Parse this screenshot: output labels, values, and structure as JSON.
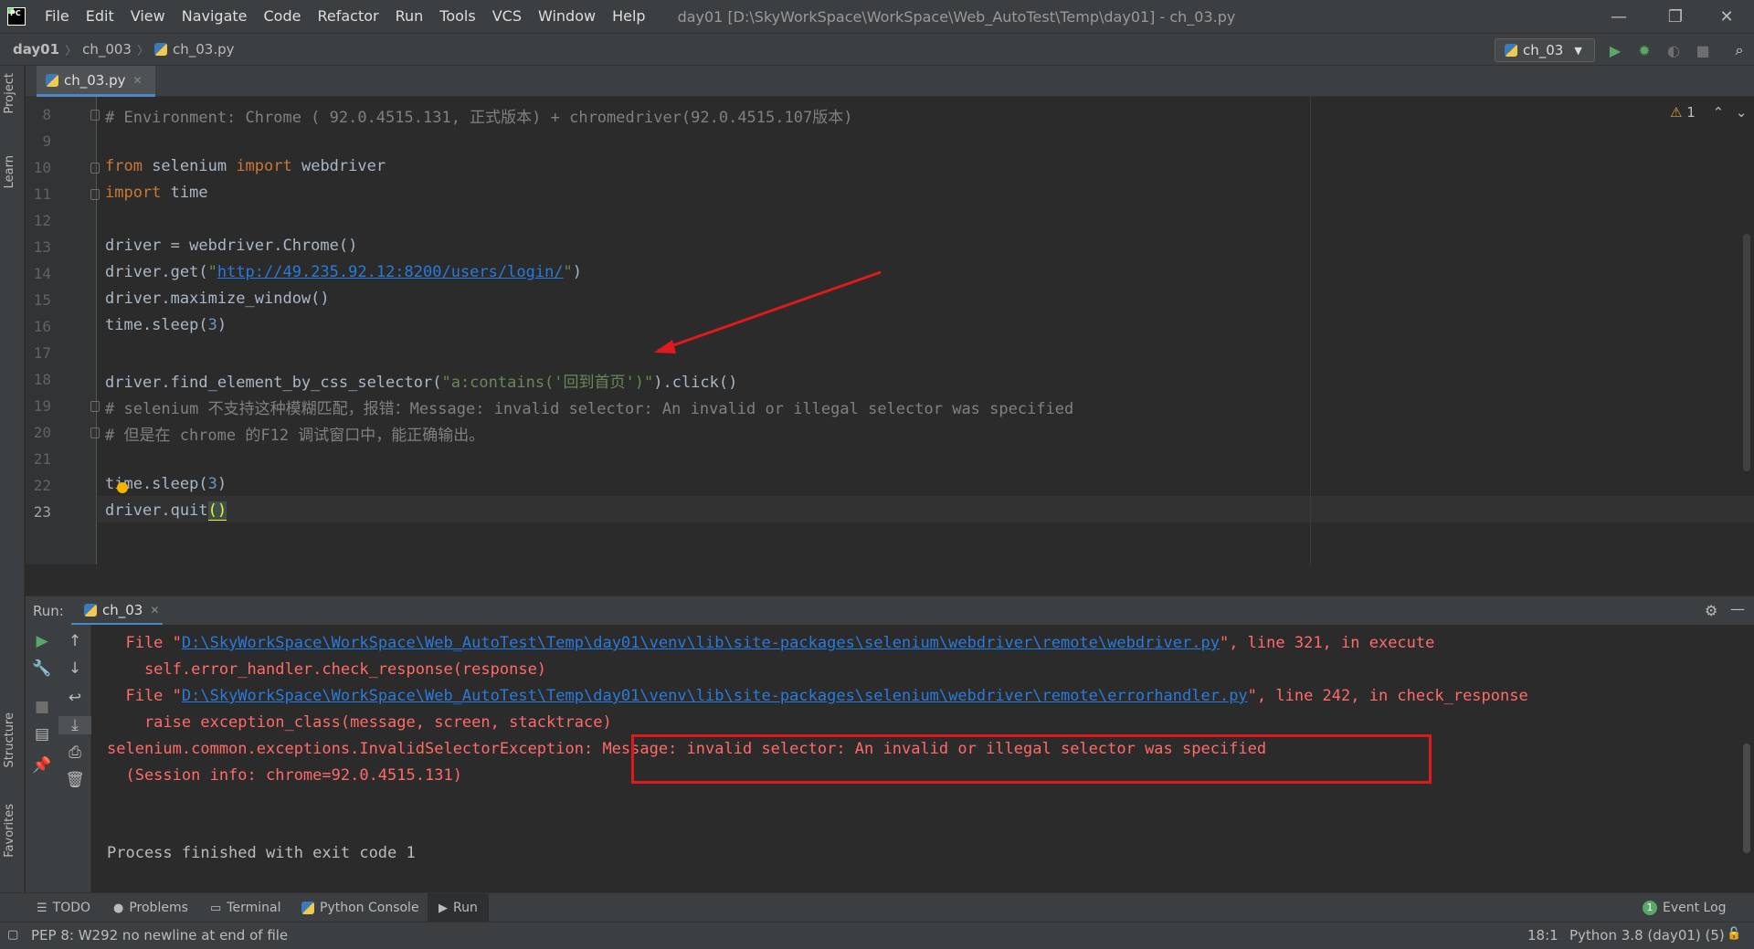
{
  "menubar": {
    "items": [
      "File",
      "Edit",
      "View",
      "Navigate",
      "Code",
      "Refactor",
      "Run",
      "Tools",
      "VCS",
      "Window",
      "Help"
    ],
    "title": "day01 [D:\\SkyWorkSpace\\WorkSpace\\Web_AutoTest\\Temp\\day01] - ch_03.py"
  },
  "navbar": {
    "crumbs": [
      "day01",
      "ch_003",
      "ch_03.py"
    ],
    "run_config": "ch_03"
  },
  "left_strip": {
    "project": "Project",
    "learn": "Learn",
    "structure": "Structure",
    "favorites": "Favorites"
  },
  "editor": {
    "tab_label": "ch_03.py",
    "warnings": "1",
    "line_numbers": [
      "8",
      "9",
      "10",
      "11",
      "12",
      "13",
      "14",
      "15",
      "16",
      "17",
      "18",
      "19",
      "20",
      "21",
      "22",
      "23"
    ],
    "lines": {
      "l8": "# Environment: Chrome ( 92.0.4515.131, 正式版本) + chromedriver(92.0.4515.107版本)",
      "l10_kw1": "from",
      "l10_mod": " selenium ",
      "l10_kw2": "import",
      "l10_rest": " webdriver",
      "l11_kw": "import",
      "l11_rest": " time",
      "l13": "driver = webdriver.Chrome()",
      "l14_a": "driver.get(",
      "l14_q1": "\"",
      "l14_url": "http://49.235.92.12:8200/users/login/",
      "l14_q2": "\"",
      "l14_b": ")",
      "l15": "driver.maximize_window()",
      "l16_a": "time.sleep(",
      "l16_n": "3",
      "l16_b": ")",
      "l18_a": "driver.find_element_by_css_selector(",
      "l18_s": "\"a:contains('回到首页')\"",
      "l18_b": ").click()",
      "l19": "# selenium 不支持这种模糊匹配，报错：Message: invalid selector: An invalid or illegal selector was specified",
      "l20": "# 但是在 chrome 的F12 调试窗口中，能正确输出。",
      "l22_a": "time.sleep(",
      "l22_n": "3",
      "l22_b": ")",
      "l23_a": "driver.quit",
      "l23_p": "()"
    }
  },
  "run": {
    "label": "Run:",
    "tab": "ch_03",
    "output": {
      "o1_a": "  File \"",
      "o1_link": "D:\\SkyWorkSpace\\WorkSpace\\Web_AutoTest\\Temp\\day01\\venv\\lib\\site-packages\\selenium\\webdriver\\remote\\webdriver.py",
      "o1_b": "\", line 321, in execute",
      "o2": "    self.error_handler.check_response(response)",
      "o3_a": "  File \"",
      "o3_link": "D:\\SkyWorkSpace\\WorkSpace\\Web_AutoTest\\Temp\\day01\\venv\\lib\\site-packages\\selenium\\webdriver\\remote\\errorhandler.py",
      "o3_b": "\", line 242, in check_response",
      "o4": "    raise exception_class(message, screen, stacktrace)",
      "o5": "selenium.common.exceptions.InvalidSelectorException: Message: invalid selector: An invalid or illegal selector was specified",
      "o6": "  (Session info: chrome=92.0.4515.131)",
      "o7": "Process finished with exit code 1"
    }
  },
  "bottom_tabs": [
    "TODO",
    "Problems",
    "Terminal",
    "Python Console",
    "Run"
  ],
  "event_log": "Event Log",
  "event_log_count": "1",
  "status": {
    "message": "PEP 8: W292 no newline at end of file",
    "position": "18:1",
    "interpreter": "Python 3.8 (day01) (5)"
  },
  "colors": {
    "annotation_red": "#e0191d",
    "error_text": "#ff6b68",
    "link": "#287bde"
  }
}
